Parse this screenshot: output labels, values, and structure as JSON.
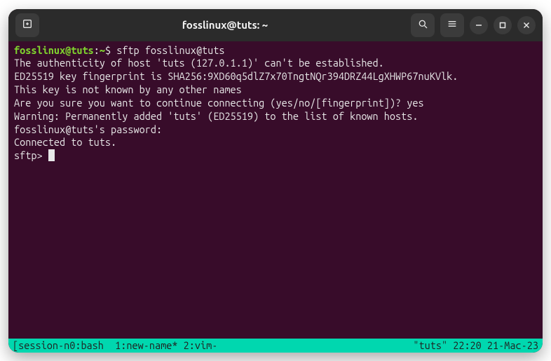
{
  "titlebar": {
    "title": "fosslinux@tuts: ~"
  },
  "terminal": {
    "prompt_user_host": "fosslinux@tuts",
    "prompt_colon": ":",
    "prompt_path": "~",
    "prompt_dollar": "$ ",
    "command": "sftp fosslinux@tuts",
    "line_auth": "The authenticity of host 'tuts (127.0.1.1)' can't be established.",
    "line_fingerprint": "ED25519 key fingerprint is SHA256:9XD60q5dlZ7x70TngtNQr394DRZ44LgXHWP67nuKVlk.",
    "line_notknown": "This key is not known by any other names",
    "line_continue_q": "Are you sure you want to continue connecting (yes/no/[fingerprint])? ",
    "answer_yes": "yes",
    "line_warning": "Warning: Permanently added 'tuts' (ED25519) to the list of known hosts.",
    "line_password": "fosslinux@tuts's password:",
    "line_connected": "Connected to tuts.",
    "sftp_prompt": "sftp> "
  },
  "statusbar": {
    "left": "[session-n0:bash  1:new-name* 2:vim-",
    "right": "\"tuts\" 22:20 21-Mac-23"
  },
  "icons": {
    "new_tab": "new-tab-icon",
    "search": "search-icon",
    "menu": "hamburger-icon",
    "minimize": "minimize-icon",
    "maximize": "maximize-icon",
    "close": "close-icon"
  }
}
